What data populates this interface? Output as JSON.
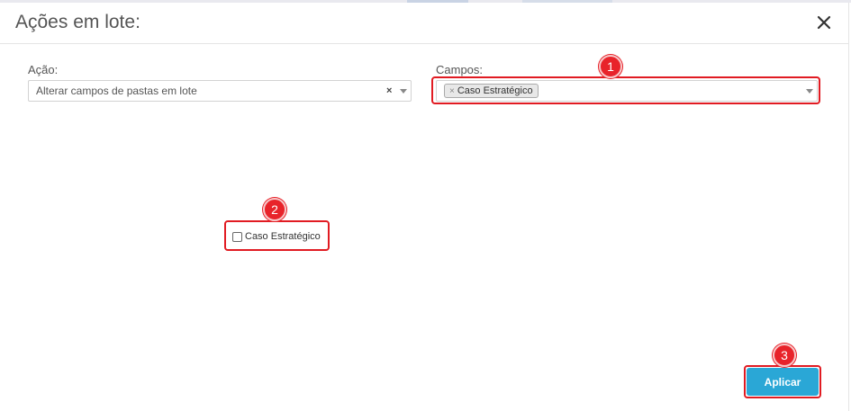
{
  "modal": {
    "title": "Ações em lote:",
    "close_icon": "close-icon"
  },
  "acao": {
    "label": "Ação:",
    "value": "Alterar campos de pastas em lote",
    "clear_symbol": "×"
  },
  "campos": {
    "label": "Campos:",
    "chips": [
      {
        "remove_symbol": "×",
        "label": "Caso Estratégico"
      }
    ]
  },
  "checkbox": {
    "label": "Caso Estratégico",
    "checked": false
  },
  "apply_button": {
    "label": "Aplicar"
  },
  "annotations": [
    {
      "number": "1"
    },
    {
      "number": "2"
    },
    {
      "number": "3"
    }
  ],
  "colors": {
    "accent": "#2aa7d6",
    "annotation_red": "#e11b22"
  }
}
